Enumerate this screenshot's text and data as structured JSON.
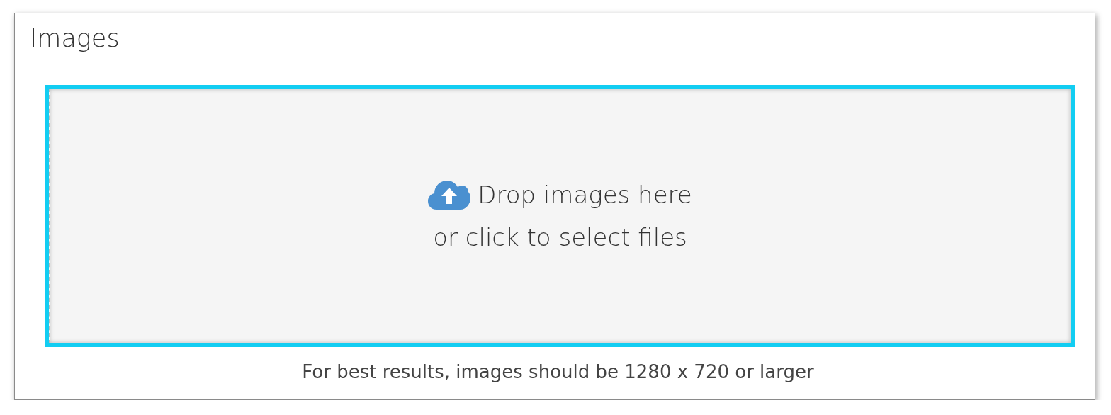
{
  "panel": {
    "title": "Images"
  },
  "dropzone": {
    "focused": true,
    "line_1": "Drop images here",
    "line_2": "or click to select files"
  },
  "hint": "For best results, images should be 1280 x 720 or larger"
}
